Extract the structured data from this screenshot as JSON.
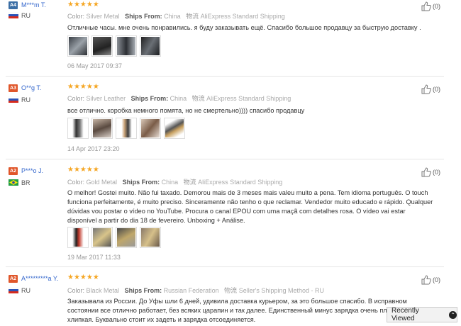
{
  "reviews": [
    {
      "level": "A4",
      "user": "M***m T.",
      "country": "RU",
      "stars": "★★★★★",
      "color_label": "Color:",
      "color": "Silver Metal",
      "ships_label": "Ships From:",
      "ships": "China",
      "shipping_method": "AliExpress Standard Shipping",
      "logistics_glyph": "物流",
      "text": "Отличные часы. мне очень понравились. я буду заказывать ещё. Спасибо большое продавцу за быструю доставку .",
      "date": "06 May 2017 09:37",
      "likes": "(0)"
    },
    {
      "level": "A3",
      "user": "O**g T.",
      "country": "RU",
      "stars": "★★★★★",
      "color_label": "Color:",
      "color": "Silver Leather",
      "ships_label": "Ships From:",
      "ships": "China",
      "shipping_method": "AliExpress Standard Shipping",
      "logistics_glyph": "物流",
      "text": "все отлично. коробка немного помята, но не смертельно)))) спасибо продавцу",
      "date": "14 Apr 2017 23:20",
      "likes": "(0)"
    },
    {
      "level": "A2",
      "user": "P***o J.",
      "country": "BR",
      "stars": "★★★★★",
      "color_label": "Color:",
      "color": "Gold Metal",
      "ships_label": "Ships From:",
      "ships": "China",
      "shipping_method": "AliExpress Standard Shipping",
      "logistics_glyph": "物流",
      "text": "O melhor! Gostei muito. Não fui taxado. Demorou mais de 3 meses mais valeu muito a pena. Tem idioma português. O touch funciona perfeitamente, é muito preciso. Sinceramente não tenho o que reclamar. Vendedor muito educado e rápido. Qualquer dúvidas vou postar o vídeo no YouTube. Procura o canal EPOU com uma maçã com detalhes rosa. O vídeo vai estar disponível a partir do dia 18 de fevereiro. Unboxing + Análise.",
      "date": "19 Mar 2017 11:33",
      "likes": "(0)"
    },
    {
      "level": "A2",
      "user": "A*********a Y.",
      "country": "RU",
      "stars": "★★★★★",
      "color_label": "Color:",
      "color": "Black Metal",
      "ships_label": "Ships From:",
      "ships": "Russian Federation",
      "shipping_method": "Seller's Shipping Method - RU",
      "logistics_glyph": "物流",
      "text": "Заказывала из России. До Уфы шли 6 дней, удивила доставка курьером, за это большое спасибо. В исправном состоянии все отлично работает, без всяких царапин и так далее. Единственный минус зарядка очень плохо держат хлипкая. Буквально стоит их задеть и зарядка отсоединяется.",
      "likes": "(0)"
    }
  ],
  "recently_viewed": {
    "label": "Recently Viewed",
    "icon": "chevron-up-icon"
  },
  "colors": {
    "star": "#f5a623",
    "link": "#3366cc",
    "badge_blue": "#3b6ea5",
    "badge_orange": "#e0562a"
  }
}
